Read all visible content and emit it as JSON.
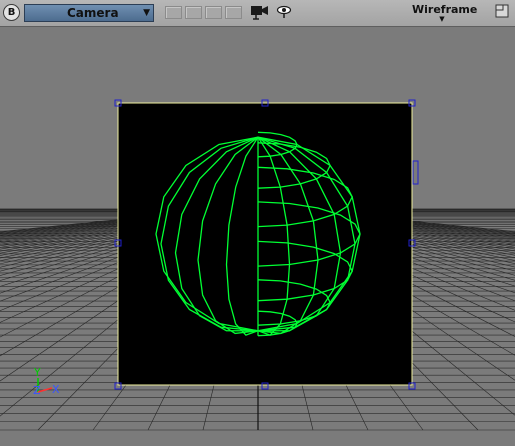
{
  "toolbar": {
    "view_menu_label": "B",
    "camera_select": "Camera",
    "shading_mode": "Wireframe",
    "icons": [
      "camera-icon",
      "eye-icon",
      "maximize-icon"
    ]
  },
  "viewport": {
    "axis_labels": {
      "y": "Y",
      "z": "Z",
      "x": "X"
    },
    "colors": {
      "background": "#7b7b7b",
      "ground_grid": "#202020",
      "frame": "#000000",
      "frame_border": "#f2f2a0",
      "handles": "#2222cc",
      "wireframe": "#00ff33",
      "axis_y": "#00cc00",
      "axis_z": "#3a54ff",
      "axis_x": "#ff3030"
    }
  }
}
